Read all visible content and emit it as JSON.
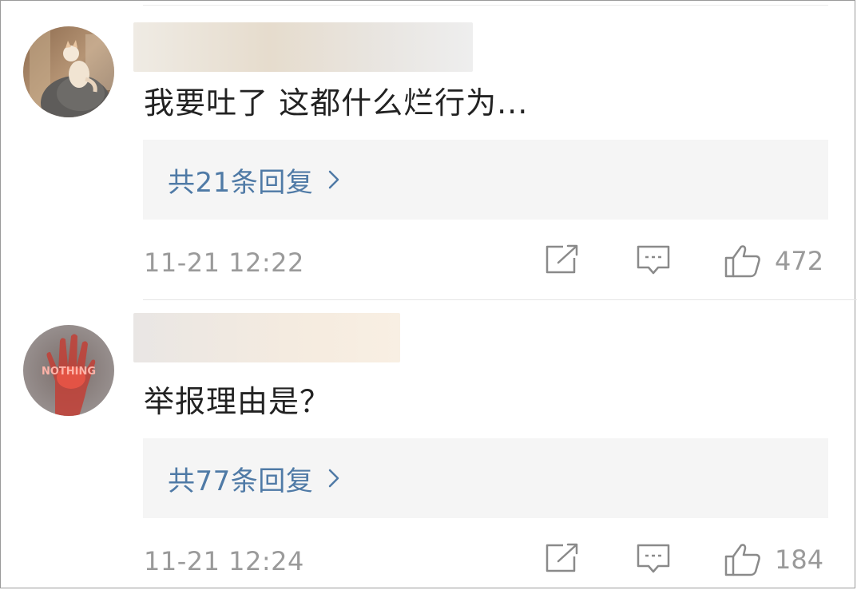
{
  "comments": [
    {
      "text": "我要吐了 这都什么烂行为...",
      "replies_label": "共21条回复",
      "timestamp": "11-21 12:22",
      "likes": "472",
      "avatar_icon": "cat-photo-avatar"
    },
    {
      "text": "举报理由是？",
      "replies_label": "共77条回复",
      "timestamp": "11-21 12:24",
      "likes": "184",
      "avatar_icon": "neon-hand-avatar",
      "avatar_text": "NOTHING"
    }
  ],
  "colors": {
    "link_blue": "#4f7aa6",
    "meta_gray": "#9a9a9a",
    "reply_box_bg": "#f5f5f5",
    "icon_gray": "#8a8a8a"
  },
  "icons": {
    "share": "share-icon",
    "comment": "comment-icon",
    "like": "thumbs-up-icon",
    "chevron": "chevron-right-icon"
  }
}
